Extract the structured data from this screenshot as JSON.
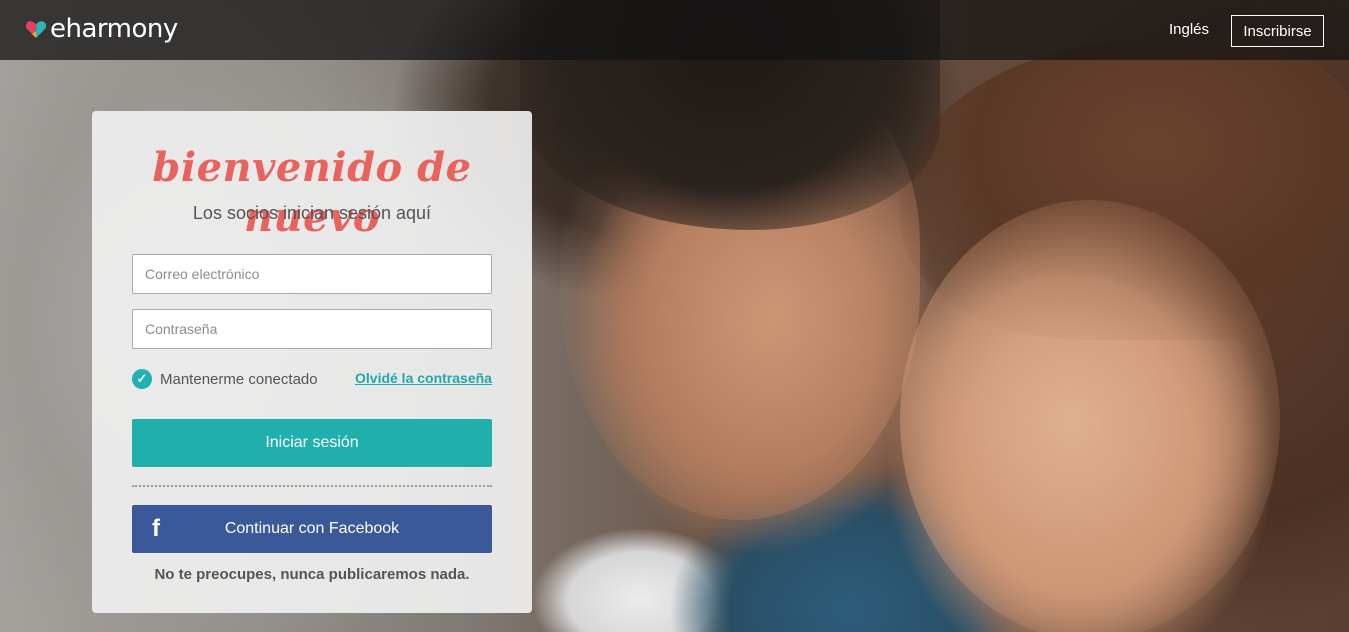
{
  "header": {
    "brand": "eharmony",
    "language_link": "Inglés",
    "signup_button": "Inscribirse"
  },
  "login": {
    "welcome": "bienvenido de nuevo",
    "subtitle": "Los socios inician sesión aquí",
    "email_placeholder": "Correo electrónico",
    "password_placeholder": "Contraseña",
    "remember_label": "Mantenerme conectado",
    "remember_checked": true,
    "forgot_link": "Olvidé la contraseña",
    "submit_label": "Iniciar sesión",
    "facebook_label": "Continuar con Facebook",
    "facebook_note": "No te preocupes, nunca publicaremos nada."
  },
  "colors": {
    "accent_teal": "#1fb0ae",
    "facebook_blue": "#3b5998",
    "welcome_coral": "#e8625e"
  },
  "icons": {
    "brand": "eharmony-heart-logo",
    "check": "check-icon",
    "facebook": "facebook-f-icon"
  }
}
